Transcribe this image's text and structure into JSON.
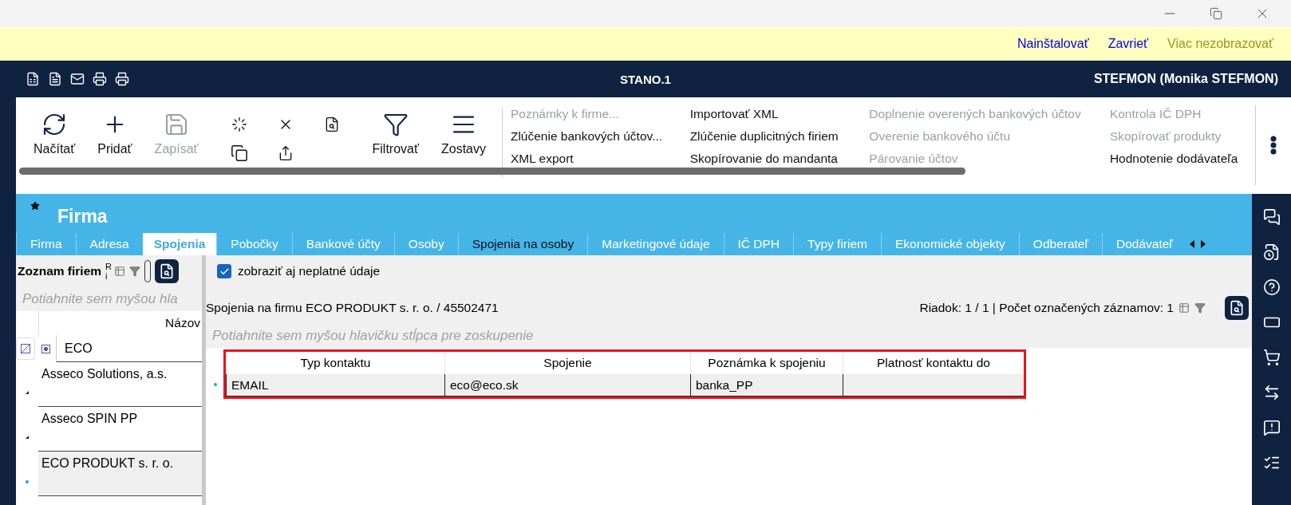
{
  "notification_bar": {
    "links": [
      {
        "label": "Nainštalovať",
        "kind": "action"
      },
      {
        "label": "Zavrieť",
        "kind": "action"
      },
      {
        "label": "Viac nezobrazovať",
        "kind": "muted"
      }
    ]
  },
  "header": {
    "title": "STANO.1",
    "user": "STEFMON (Monika STEFMON)"
  },
  "toolbar": {
    "buttons": [
      {
        "label": "Načítať",
        "disabled": false
      },
      {
        "label": "Pridať",
        "disabled": false
      },
      {
        "label": "Zapísať",
        "disabled": true
      },
      {
        "label": "Filtrovať",
        "disabled": false
      },
      {
        "label": "Zostavy",
        "disabled": false
      }
    ],
    "commands": [
      [
        {
          "label": "Poznámky k firme...",
          "disabled": true
        },
        {
          "label": "Zlúčenie bankových účtov...",
          "disabled": false
        },
        {
          "label": "XML export",
          "disabled": false
        }
      ],
      [
        {
          "label": "Importovať XML",
          "disabled": false
        },
        {
          "label": "Zlúčenie duplicitných firiem",
          "disabled": false
        },
        {
          "label": "Skopírovanie do mandanta",
          "disabled": false
        }
      ],
      [
        {
          "label": "Doplnenie overených bankových účtov",
          "disabled": true
        },
        {
          "label": "Overenie bankového účtu",
          "disabled": true
        },
        {
          "label": "Párovanie účtov",
          "disabled": true
        }
      ],
      [
        {
          "label": "Kontrola IČ DPH",
          "disabled": true
        },
        {
          "label": "Skopírovať produkty",
          "disabled": true
        },
        {
          "label": "Hodnotenie dodávateľa",
          "disabled": false
        }
      ]
    ]
  },
  "page": {
    "title": "Firma",
    "tabs": [
      {
        "label": "Firma",
        "selected": false,
        "hovered": false
      },
      {
        "label": "Adresa",
        "selected": false,
        "hovered": false
      },
      {
        "label": "Spojenia",
        "selected": true,
        "hovered": false
      },
      {
        "label": "Pobočky",
        "selected": false,
        "hovered": false
      },
      {
        "label": "Bankové účty",
        "selected": false,
        "hovered": false
      },
      {
        "label": "Osoby",
        "selected": false,
        "hovered": false
      },
      {
        "label": "Spojenia na osoby",
        "selected": false,
        "hovered": true
      },
      {
        "label": "Marketingové údaje",
        "selected": false,
        "hovered": false
      },
      {
        "label": "IČ DPH",
        "selected": false,
        "hovered": false
      },
      {
        "label": "Typy firiem",
        "selected": false,
        "hovered": false
      },
      {
        "label": "Ekonomické objekty",
        "selected": false,
        "hovered": false
      },
      {
        "label": "Odberateľ",
        "selected": false,
        "hovered": false
      },
      {
        "label": "Dodávateľ",
        "selected": false,
        "hovered": false
      }
    ]
  },
  "company_list": {
    "title": "Zoznam firiem",
    "cut_label": "Ri",
    "group_hint": "Potiahnite sem myšou hla",
    "column": "Názov",
    "filter": "ECO",
    "rows": [
      {
        "name": "Asseco Solutions, a.s.",
        "selected": false
      },
      {
        "name": "Asseco SPIN PP",
        "selected": false
      },
      {
        "name": "ECO PRODUKT s. r. o.",
        "selected": true
      }
    ]
  },
  "contacts": {
    "show_invalid": {
      "label": "zobraziť aj neplatné údaje",
      "checked": true
    },
    "title": "Spojenia na firmu ECO PRODUKT s. r. o. / 45502471",
    "status": "Riadok: 1 / 1 | Počet označených záznamov: 1",
    "group_hint": "Potiahnite sem myšou hlavičku stĺpca pre zoskupenie",
    "columns": [
      "Typ kontaktu",
      "Spojenie",
      "Poznámka k spojeniu",
      "Platnosť kontaktu do"
    ],
    "rows": [
      {
        "type": "EMAIL",
        "contact": "eco@eco.sk",
        "note": "banka_PP",
        "selected": true
      }
    ]
  }
}
